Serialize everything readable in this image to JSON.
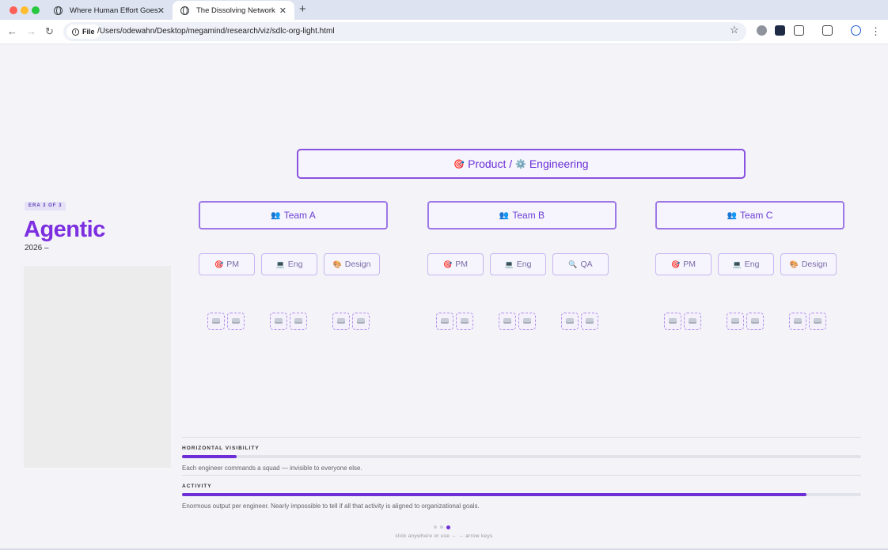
{
  "browser": {
    "tabs": [
      {
        "title": "Where Human Effort Goes"
      },
      {
        "title": "The Dissolving Network"
      }
    ],
    "new_tab_symbol": "+",
    "address": {
      "chip_label": "File",
      "url": "/Users/odewahn/Desktop/megamind/research/viz/sdlc-org-light.html"
    }
  },
  "era": {
    "badge": "ERA 3 OF 3",
    "title": "Agentic",
    "year": "2026 –"
  },
  "org": {
    "top": {
      "icon1": "🎯",
      "label1": "Product /",
      "icon2": "⚙️",
      "label2": "Engineering"
    },
    "teams": [
      {
        "icon": "👥",
        "label": "Team A",
        "roles": [
          {
            "icon": "🎯",
            "label": "PM"
          },
          {
            "icon": "💻",
            "label": "Eng"
          },
          {
            "icon": "🎨",
            "label": "Design"
          }
        ]
      },
      {
        "icon": "👥",
        "label": "Team B",
        "roles": [
          {
            "icon": "🎯",
            "label": "PM"
          },
          {
            "icon": "💻",
            "label": "Eng"
          },
          {
            "icon": "🔍",
            "label": "QA"
          }
        ]
      },
      {
        "icon": "👥",
        "label": "Team C",
        "roles": [
          {
            "icon": "🎯",
            "label": "PM"
          },
          {
            "icon": "💻",
            "label": "Eng"
          },
          {
            "icon": "🎨",
            "label": "Design"
          }
        ]
      }
    ]
  },
  "metrics": [
    {
      "label": "HORIZONTAL VISIBILITY",
      "value_pct": 8,
      "description": "Each engineer commands a squad — invisible to everyone else."
    },
    {
      "label": "ACTIVITY",
      "value_pct": 92,
      "description": "Enormous output per engineer. Nearly impossible to tell if all that activity is aligned to organizational goals."
    }
  ],
  "pager": {
    "current": 3,
    "total": 3,
    "hint": "click anywhere or use ← → arrow keys"
  },
  "colors": {
    "accent": "#6e2fd6",
    "title": "#7c2fe0"
  }
}
